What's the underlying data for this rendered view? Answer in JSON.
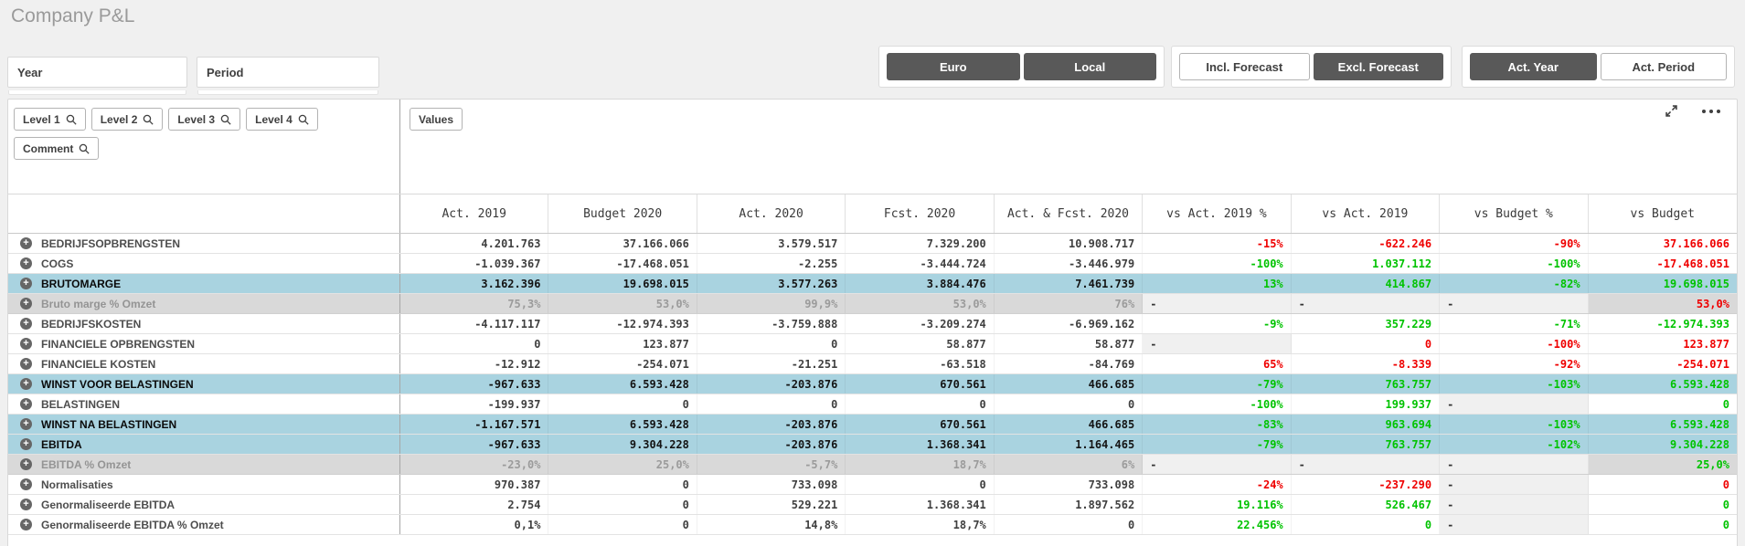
{
  "page": {
    "title": "Company P&L"
  },
  "filters": {
    "year_label": "Year",
    "period_label": "Period"
  },
  "toggles": {
    "currency": [
      {
        "label": "Euro",
        "active": true
      },
      {
        "label": "Local",
        "active": true
      }
    ],
    "forecast": [
      {
        "label": "Incl. Forecast",
        "active": false
      },
      {
        "label": "Excl. Forecast",
        "active": true
      }
    ],
    "actuals": [
      {
        "label": "Act. Year",
        "active": true
      },
      {
        "label": "Act. Period",
        "active": false
      }
    ]
  },
  "icons": {
    "search": "magnifier-icon",
    "expand": "fullscreen-arrows-icon",
    "more": "ellipsis-icon",
    "row_expand": "plus-circle-icon"
  },
  "table": {
    "dimension_buttons_row1": [
      "Level 1",
      "Level 2",
      "Level 3",
      "Level 4"
    ],
    "dimension_buttons_row2": [
      "Comment"
    ],
    "values_button_label": "Values",
    "columns": [
      "Act. 2019",
      "Budget 2020",
      "Act. 2020",
      "Fcst. 2020",
      "Act. & Fcst. 2020",
      "vs Act. 2019 %",
      "vs Act. 2019",
      "vs Budget %",
      "vs Budget"
    ],
    "rows": [
      {
        "label": "BEDRIJFSOPBRENGSTEN",
        "style": "normal",
        "cells": [
          {
            "v": "4.201.763"
          },
          {
            "v": "37.166.066"
          },
          {
            "v": "3.579.517"
          },
          {
            "v": "7.329.200"
          },
          {
            "v": "10.908.717"
          },
          {
            "v": "-15%",
            "c": "red"
          },
          {
            "v": "-622.246",
            "c": "red"
          },
          {
            "v": "-90%",
            "c": "red"
          },
          {
            "v": "37.166.066",
            "c": "red"
          }
        ]
      },
      {
        "label": "COGS",
        "style": "normal",
        "cells": [
          {
            "v": "-1.039.367"
          },
          {
            "v": "-17.468.051"
          },
          {
            "v": "-2.255"
          },
          {
            "v": "-3.444.724"
          },
          {
            "v": "-3.446.979"
          },
          {
            "v": "-100%",
            "c": "green"
          },
          {
            "v": "1.037.112",
            "c": "green"
          },
          {
            "v": "-100%",
            "c": "green"
          },
          {
            "v": "-17.468.051",
            "c": "red"
          }
        ]
      },
      {
        "label": "BRUTOMARGE",
        "style": "blue",
        "cells": [
          {
            "v": "3.162.396"
          },
          {
            "v": "19.698.015"
          },
          {
            "v": "3.577.263"
          },
          {
            "v": "3.884.476"
          },
          {
            "v": "7.461.739"
          },
          {
            "v": "13%",
            "c": "green"
          },
          {
            "v": "414.867",
            "c": "green"
          },
          {
            "v": "-82%",
            "c": "green"
          },
          {
            "v": "19.698.015",
            "c": "green"
          }
        ]
      },
      {
        "label": "Bruto marge % Omzet",
        "style": "gray",
        "cells": [
          {
            "v": "75,3%"
          },
          {
            "v": "53,0%"
          },
          {
            "v": "99,9%"
          },
          {
            "v": "53,0%"
          },
          {
            "v": "76%"
          },
          {
            "v": "-",
            "dash": true
          },
          {
            "v": "-",
            "dash": true
          },
          {
            "v": "-",
            "dash": true
          },
          {
            "v": "53,0%",
            "c": "red"
          }
        ]
      },
      {
        "label": "BEDRIJFSKOSTEN",
        "style": "normal",
        "cells": [
          {
            "v": "-4.117.117"
          },
          {
            "v": "-12.974.393"
          },
          {
            "v": "-3.759.888"
          },
          {
            "v": "-3.209.274"
          },
          {
            "v": "-6.969.162"
          },
          {
            "v": "-9%",
            "c": "green"
          },
          {
            "v": "357.229",
            "c": "green"
          },
          {
            "v": "-71%",
            "c": "green"
          },
          {
            "v": "-12.974.393",
            "c": "green"
          }
        ]
      },
      {
        "label": "FINANCIELE OPBRENGSTEN",
        "style": "normal",
        "cells": [
          {
            "v": "0"
          },
          {
            "v": "123.877"
          },
          {
            "v": "0"
          },
          {
            "v": "58.877"
          },
          {
            "v": "58.877"
          },
          {
            "v": "-",
            "dash": true
          },
          {
            "v": "0",
            "c": "red"
          },
          {
            "v": "-100%",
            "c": "red"
          },
          {
            "v": "123.877",
            "c": "red"
          }
        ]
      },
      {
        "label": "FINANCIELE KOSTEN",
        "style": "normal",
        "cells": [
          {
            "v": "-12.912"
          },
          {
            "v": "-254.071"
          },
          {
            "v": "-21.251"
          },
          {
            "v": "-63.518"
          },
          {
            "v": "-84.769"
          },
          {
            "v": "65%",
            "c": "red"
          },
          {
            "v": "-8.339",
            "c": "red"
          },
          {
            "v": "-92%",
            "c": "red"
          },
          {
            "v": "-254.071",
            "c": "red"
          }
        ]
      },
      {
        "label": "WINST VOOR BELASTINGEN",
        "style": "blue",
        "cells": [
          {
            "v": "-967.633"
          },
          {
            "v": "6.593.428"
          },
          {
            "v": "-203.876"
          },
          {
            "v": "670.561"
          },
          {
            "v": "466.685"
          },
          {
            "v": "-79%",
            "c": "green"
          },
          {
            "v": "763.757",
            "c": "green"
          },
          {
            "v": "-103%",
            "c": "green"
          },
          {
            "v": "6.593.428",
            "c": "green"
          }
        ]
      },
      {
        "label": "BELASTINGEN",
        "style": "normal",
        "cells": [
          {
            "v": "-199.937"
          },
          {
            "v": "0"
          },
          {
            "v": "0"
          },
          {
            "v": "0"
          },
          {
            "v": "0"
          },
          {
            "v": "-100%",
            "c": "green"
          },
          {
            "v": "199.937",
            "c": "green"
          },
          {
            "v": "-",
            "dash": true
          },
          {
            "v": "0",
            "c": "green"
          }
        ]
      },
      {
        "label": "WINST NA BELASTINGEN",
        "style": "blue",
        "cells": [
          {
            "v": "-1.167.571"
          },
          {
            "v": "6.593.428"
          },
          {
            "v": "-203.876"
          },
          {
            "v": "670.561"
          },
          {
            "v": "466.685"
          },
          {
            "v": "-83%",
            "c": "green"
          },
          {
            "v": "963.694",
            "c": "green"
          },
          {
            "v": "-103%",
            "c": "green"
          },
          {
            "v": "6.593.428",
            "c": "green"
          }
        ]
      },
      {
        "label": "EBITDA",
        "style": "blue",
        "cells": [
          {
            "v": "-967.633"
          },
          {
            "v": "9.304.228"
          },
          {
            "v": "-203.876"
          },
          {
            "v": "1.368.341"
          },
          {
            "v": "1.164.465"
          },
          {
            "v": "-79%",
            "c": "green"
          },
          {
            "v": "763.757",
            "c": "green"
          },
          {
            "v": "-102%",
            "c": "green"
          },
          {
            "v": "9.304.228",
            "c": "green"
          }
        ]
      },
      {
        "label": "EBITDA % Omzet",
        "style": "gray",
        "cells": [
          {
            "v": "-23,0%"
          },
          {
            "v": "25,0%"
          },
          {
            "v": "-5,7%"
          },
          {
            "v": "18,7%"
          },
          {
            "v": "6%"
          },
          {
            "v": "-",
            "dash": true
          },
          {
            "v": "-",
            "dash": true
          },
          {
            "v": "-",
            "dash": true
          },
          {
            "v": "25,0%",
            "c": "green"
          }
        ]
      },
      {
        "label": "Normalisaties",
        "style": "normal",
        "cells": [
          {
            "v": "970.387"
          },
          {
            "v": "0"
          },
          {
            "v": "733.098"
          },
          {
            "v": "0"
          },
          {
            "v": "733.098"
          },
          {
            "v": "-24%",
            "c": "red"
          },
          {
            "v": "-237.290",
            "c": "red"
          },
          {
            "v": "-",
            "dash": true
          },
          {
            "v": "0",
            "c": "red"
          }
        ]
      },
      {
        "label": "Genormaliseerde EBITDA",
        "style": "normal",
        "cells": [
          {
            "v": "2.754"
          },
          {
            "v": "0"
          },
          {
            "v": "529.221"
          },
          {
            "v": "1.368.341"
          },
          {
            "v": "1.897.562"
          },
          {
            "v": "19.116%",
            "c": "green"
          },
          {
            "v": "526.467",
            "c": "green"
          },
          {
            "v": "-",
            "dash": true
          },
          {
            "v": "0",
            "c": "green"
          }
        ]
      },
      {
        "label": "Genormaliseerde EBITDA % Omzet",
        "style": "normal",
        "cells": [
          {
            "v": "0,1%"
          },
          {
            "v": "0"
          },
          {
            "v": "14,8%"
          },
          {
            "v": "18,7%"
          },
          {
            "v": "0"
          },
          {
            "v": "22.456%",
            "c": "green"
          },
          {
            "v": "0",
            "c": "green"
          },
          {
            "v": "-",
            "dash": true
          },
          {
            "v": "0",
            "c": "green"
          }
        ]
      }
    ]
  },
  "colors": {
    "positive": "#00c300",
    "negative": "#ef0000",
    "highlight_row": "#a9d3e0",
    "percent_row": "#d9d9d9",
    "selected_button": "#595959"
  }
}
